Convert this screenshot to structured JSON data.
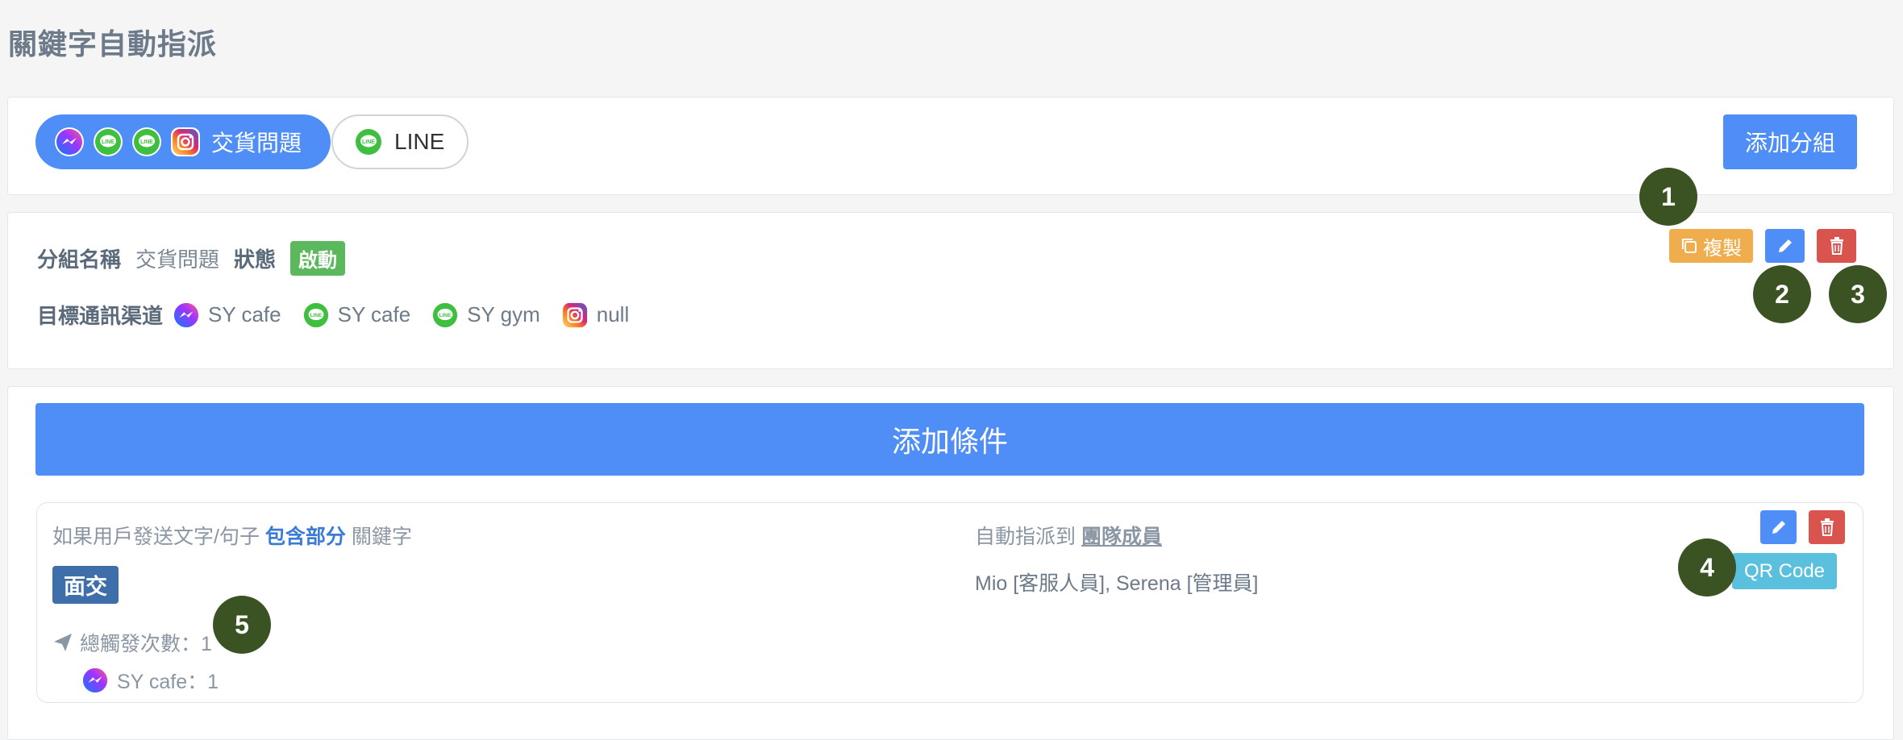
{
  "page": {
    "title": "關鍵字自動指派"
  },
  "groups": {
    "tabs": [
      {
        "label": "交貨問題",
        "icons": [
          "messenger-icon",
          "line-icon",
          "line-icon",
          "instagram-icon"
        ],
        "active": true
      },
      {
        "label": "LINE",
        "icons": [
          "line-icon"
        ],
        "active": false
      }
    ],
    "add_label": "添加分組"
  },
  "group_info": {
    "name_label": "分組名稱",
    "name_value": "交貨問題",
    "status_label": "狀態",
    "status_value": "啟動",
    "channels_label": "目標通訊渠道",
    "channels": [
      {
        "icon": "messenger-icon",
        "name": "SY cafe"
      },
      {
        "icon": "line-icon",
        "name": "SY cafe"
      },
      {
        "icon": "line-icon",
        "name": "SY gym"
      },
      {
        "icon": "instagram-icon",
        "name": "null"
      }
    ],
    "copy_label": "複製"
  },
  "conditions": {
    "add_label": "添加條件",
    "items": [
      {
        "prefix": "如果用戶發送文字/句子",
        "match_type": "包含部分",
        "suffix": "關鍵字",
        "keyword": "面交",
        "assign_prefix": "自動指派到",
        "assign_target": "團隊成員",
        "assignees": "Mio [客服人員], Serena [管理員]",
        "total_triggers": "總觸發次數：1",
        "channel_trigger": "SY cafe：1",
        "qr_label": "QR Code"
      }
    ]
  },
  "markers": [
    "1",
    "2",
    "3",
    "4",
    "5"
  ],
  "colors": {
    "primary": "#4f8ef7",
    "warning": "#f0ad4e",
    "danger": "#d9534f",
    "success": "#5cb85c",
    "info": "#5bc0de",
    "keyword": "#3f6faa",
    "marker": "#3b5323"
  }
}
